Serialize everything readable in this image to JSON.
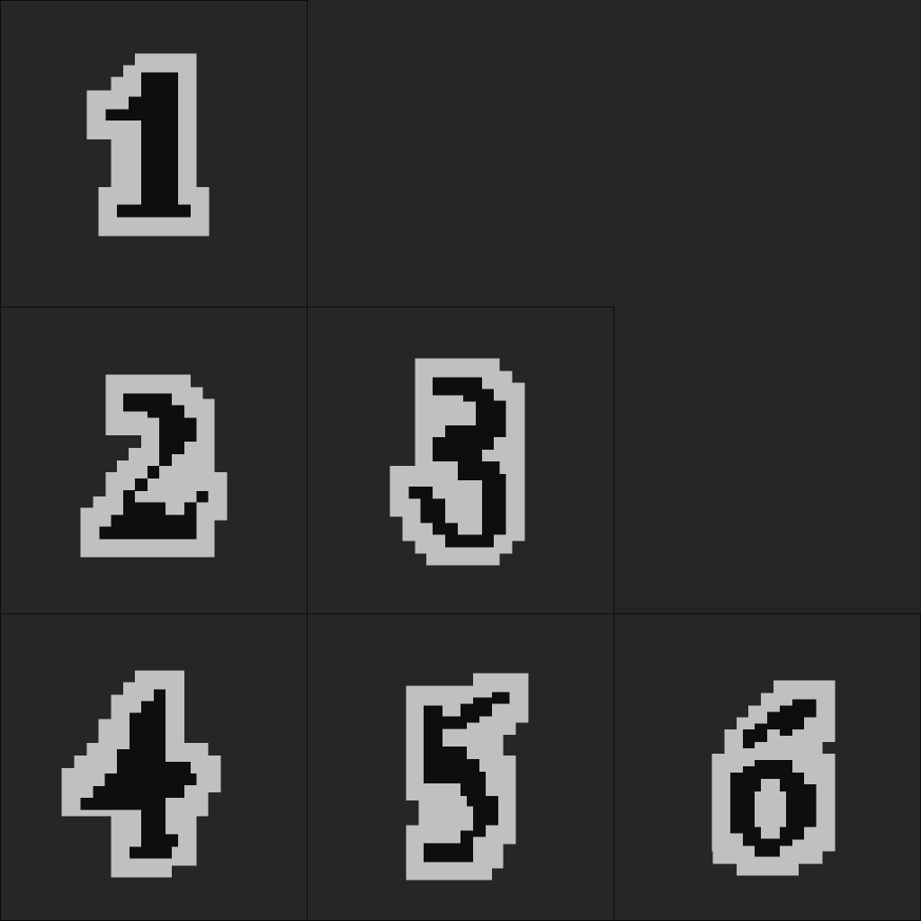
{
  "board": {
    "cells": [
      {
        "id": "cell-1",
        "label": "1",
        "row": 0,
        "col": 0
      },
      {
        "id": "cell-2",
        "label": "2",
        "row": 1,
        "col": 0
      },
      {
        "id": "cell-3",
        "label": "3",
        "row": 1,
        "col": 1
      },
      {
        "id": "cell-4",
        "label": "4",
        "row": 2,
        "col": 0
      },
      {
        "id": "cell-5",
        "label": "5",
        "row": 2,
        "col": 1
      },
      {
        "id": "cell-6",
        "label": "6",
        "row": 2,
        "col": 2
      }
    ]
  },
  "colors": {
    "background": "#252525",
    "tile": "#262626",
    "grid_line": "#0b0b0b",
    "digit_outline": "#c0c0c0",
    "digit_fill": "#0e0e0e"
  }
}
